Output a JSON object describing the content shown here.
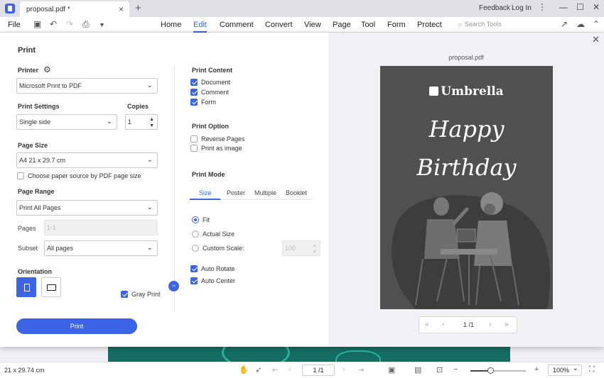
{
  "app": {
    "doc_tab": "proposal.pdf *",
    "feedback": "Feedback",
    "login": "Log In"
  },
  "menu": {
    "file": "File",
    "items": [
      "Home",
      "Edit",
      "Comment",
      "Convert",
      "View",
      "Page",
      "Tool",
      "Form",
      "Protect"
    ],
    "active": "Edit",
    "search_placeholder": "Search Tools"
  },
  "dialog": {
    "title": "Print",
    "printer_label": "Printer",
    "printer_value": "Microsoft Print to PDF",
    "print_settings_label": "Print Settings",
    "print_settings_value": "Single side",
    "copies_label": "Copies",
    "copies_value": "1",
    "page_size_label": "Page Size",
    "page_size_value": "A4 21 x 29.7 cm",
    "paper_source_label": "Choose paper source by PDF page size",
    "page_range_label": "Page Range",
    "page_range_value": "Print All Pages",
    "pages_label": "Pages",
    "pages_placeholder": "1-1",
    "subset_label": "Subset",
    "subset_value": "All pages",
    "orientation_label": "Orientation",
    "gray_print_label": "Gray Print",
    "print_button": "Print",
    "print_content_label": "Print Content",
    "content_document": "Document",
    "content_comment": "Comment",
    "content_form": "Form",
    "print_option_label": "Print Option",
    "reverse_pages": "Reverse Pages",
    "print_as_image": "Print as image",
    "print_mode_label": "Print Mode",
    "mode_tabs": [
      "Size",
      "Poster",
      "Multiple",
      "Booklet"
    ],
    "fit": "Fit",
    "actual_size": "Actual Size",
    "custom_scale": "Custom Scale:",
    "custom_scale_value": "100",
    "auto_rotate": "Auto Rotate",
    "auto_center": "Auto Center"
  },
  "preview": {
    "filename": "proposal.pdf",
    "brand": "Umbrella",
    "greeting_line1": "Happy",
    "greeting_line2": "Birthday",
    "page_indicator": "1 /1"
  },
  "status": {
    "dimensions": "21 x 29.74 cm",
    "page_field": "1 /1",
    "zoom": "100%",
    "zoom_fraction": 0.36
  }
}
